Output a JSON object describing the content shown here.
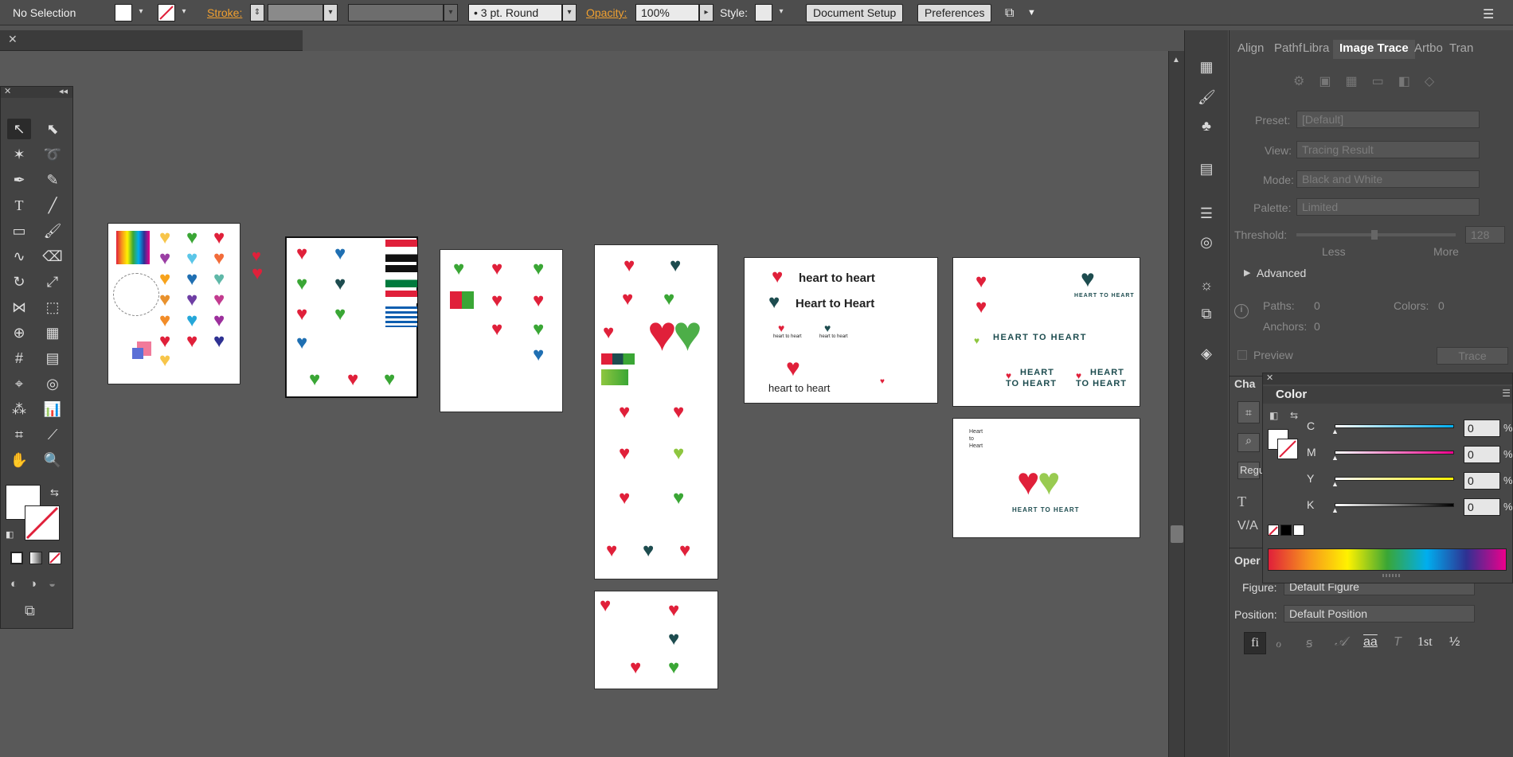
{
  "control_bar": {
    "selection_label": "No Selection",
    "stroke_label": "Stroke:",
    "stroke_weight_value": "",
    "brush_value": "",
    "stroke_profile": "3 pt. Round",
    "opacity_label": "Opacity:",
    "opacity_value": "100%",
    "style_label": "Style:",
    "document_setup": "Document Setup",
    "preferences": "Preferences"
  },
  "panels": {
    "tabs": [
      "Align",
      "Pathf",
      "Libra",
      "Image Trace",
      "Artbo",
      "Tran"
    ],
    "active_tab": "Image Trace",
    "image_trace": {
      "preset_label": "Preset:",
      "preset_value": "[Default]",
      "view_label": "View:",
      "view_value": "Tracing Result",
      "mode_label": "Mode:",
      "mode_value": "Black and White",
      "palette_label": "Palette:",
      "palette_value": "Limited",
      "threshold_label": "Threshold:",
      "threshold_value": "128",
      "less_label": "Less",
      "more_label": "More",
      "advanced_label": "Advanced",
      "paths_label": "Paths:",
      "paths_value": "0",
      "colors_label": "Colors:",
      "colors_value": "0",
      "anchors_label": "Anchors:",
      "anchors_value": "0",
      "preview_label": "Preview",
      "trace_button": "Trace"
    },
    "character": {
      "tab_label": "Cha",
      "font_style_value": "Regu"
    },
    "opentype": {
      "tab_label": "Oper",
      "figure_label": "Figure:",
      "figure_value": "Default Figure",
      "position_label": "Position:",
      "position_value": "Default Position",
      "glyphs": [
        "fi",
        "ℴ",
        "ꞩ",
        "𝒜",
        "aa",
        "T",
        "1st",
        "½"
      ]
    },
    "color": {
      "title": "Color",
      "channels": [
        {
          "label": "C",
          "value": "0",
          "unit": "%",
          "gradient": "linear-gradient(90deg,#fff,#00aeef)"
        },
        {
          "label": "M",
          "value": "0",
          "unit": "%",
          "gradient": "linear-gradient(90deg,#fff,#ec008c)"
        },
        {
          "label": "Y",
          "value": "0",
          "unit": "%",
          "gradient": "linear-gradient(90deg,#fff,#fff200)"
        },
        {
          "label": "K",
          "value": "0",
          "unit": "%",
          "gradient": "linear-gradient(90deg,#fff,#000)"
        }
      ]
    }
  },
  "artboards": {
    "logo_texts": [
      "heart to heart",
      "Heart to Heart",
      "heart to heart",
      "heart to heart",
      "heart to heart",
      "HEART TO HEART",
      "HEART TO HEART",
      "HEART",
      "TO HEART",
      "HEART",
      "TO HEART",
      "Heart",
      "to",
      "Heart",
      "HEART TO HEART"
    ]
  },
  "colors": {
    "brand_red": "#e0203a",
    "brand_green": "#3aa635",
    "brand_dark": "#1d4c4f",
    "brand_lime": "#8ec63f",
    "accent_orange": "#e8912d"
  }
}
